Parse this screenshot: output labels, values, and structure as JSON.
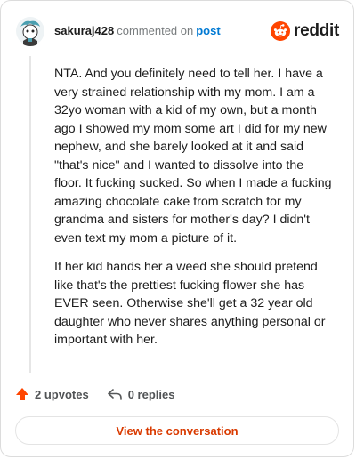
{
  "header": {
    "username": "sakuraj428",
    "verb": "commented on",
    "post_link": "post",
    "brand": "reddit"
  },
  "comment": {
    "paragraphs": [
      "NTA. And you definitely need to tell her. I have a very strained relationship with my mom. I am a 32yo woman with a kid of my own, but a month ago I showed my mom some art I did for my new nephew, and she barely looked at it and said \"that's nice\" and I wanted to dissolve into the floor. It fucking sucked. So when I made a fucking amazing chocolate cake from scratch for my grandma and sisters for mother's day? I didn't even text my mom a picture of it.",
      "If her kid hands her a weed she should pretend like that's the prettiest fucking flower she has EVER seen. Otherwise she'll get a 32 year old daughter who never shares anything personal or important with her."
    ]
  },
  "actions": {
    "upvotes": "2 upvotes",
    "replies": "0 replies"
  },
  "cta": {
    "label": "View the conversation"
  },
  "colors": {
    "brand": "#ff4500",
    "link": "#0079d3",
    "cta_text": "#d93a00",
    "avatar_accent": "#4a9fb0"
  },
  "icons": {
    "avatar": "snoo-avatar-icon",
    "brand": "reddit-logo-icon",
    "upvote": "upvote-arrow-icon",
    "reply": "reply-arrow-icon"
  }
}
